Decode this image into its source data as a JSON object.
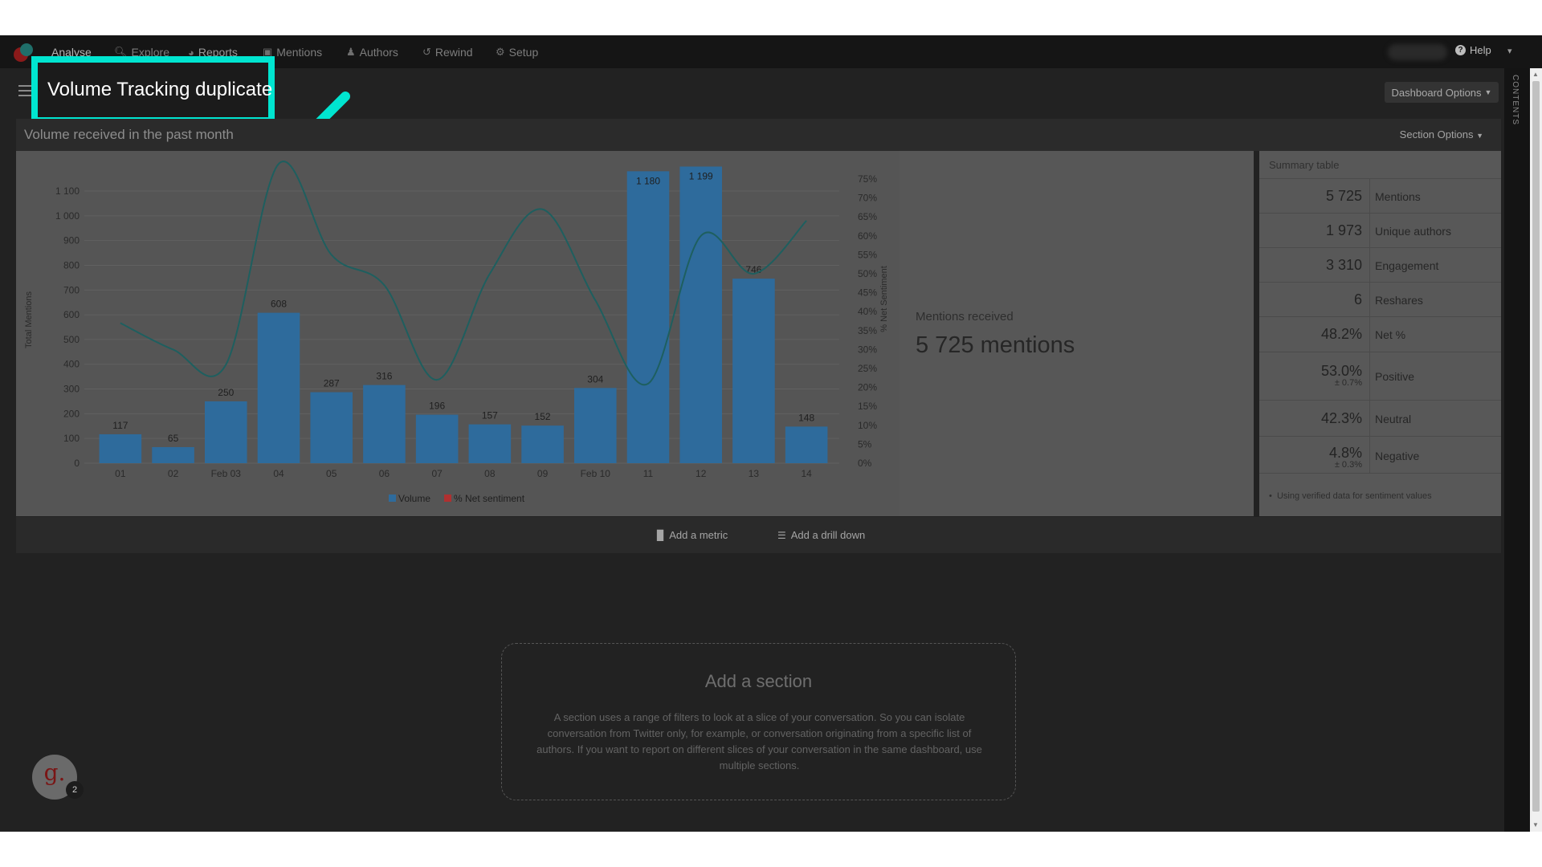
{
  "nav": {
    "items": [
      {
        "label": "Analyse",
        "icon": ""
      },
      {
        "label": "Explore",
        "icon": "search-icon"
      },
      {
        "label": "Reports",
        "icon": "pie-chart-icon"
      },
      {
        "label": "Mentions",
        "icon": "speech-bubble-icon"
      },
      {
        "label": "Authors",
        "icon": "person-icon"
      },
      {
        "label": "Rewind",
        "icon": "history-icon"
      },
      {
        "label": "Setup",
        "icon": "gear-icon"
      }
    ],
    "active": "Reports",
    "help_label": "Help"
  },
  "dashboard": {
    "title": "Volume Tracking duplicate",
    "options_label": "Dashboard Options",
    "contents_label": "CONTENTS"
  },
  "section": {
    "title": "Volume received in the past month",
    "options_label": "Section Options"
  },
  "chart_data": {
    "type": "bar",
    "categories": [
      "01",
      "02",
      "Feb 03",
      "04",
      "05",
      "06",
      "07",
      "08",
      "09",
      "Feb 10",
      "11",
      "12",
      "13",
      "14"
    ],
    "series": [
      {
        "name": "Volume",
        "type": "bar",
        "values": [
          117,
          65,
          250,
          608,
          287,
          316,
          196,
          157,
          152,
          304,
          1180,
          1199,
          746,
          148
        ],
        "value_labels": [
          "117",
          "65",
          "250",
          "608",
          "287",
          "316",
          "196",
          "157",
          "152",
          "304",
          "1 180",
          "1 199",
          "746",
          "148"
        ]
      },
      {
        "name": "% Net sentiment",
        "type": "line",
        "axis": "right",
        "values": [
          37,
          30,
          26,
          79,
          55,
          47,
          22,
          50,
          67,
          43,
          21,
          60,
          50,
          64
        ]
      }
    ],
    "ylabel": "Total Mentions",
    "y2label": "% Net Sentiment",
    "ylim": [
      0,
      1100
    ],
    "y_ticks": [
      "0",
      "100",
      "200",
      "300",
      "400",
      "500",
      "600",
      "700",
      "800",
      "900",
      "1 000",
      "1 100"
    ],
    "y2lim": [
      0,
      75
    ],
    "y2_ticks": [
      "0%",
      "5%",
      "10%",
      "15%",
      "20%",
      "25%",
      "30%",
      "35%",
      "40%",
      "45%",
      "50%",
      "55%",
      "60%",
      "65%",
      "70%",
      "75%"
    ],
    "grid": true,
    "legend": "bottom-center",
    "colors": {
      "bar": "#2e6b9c",
      "line": "#1e5f5f",
      "legend_sentiment": "#b03030"
    }
  },
  "mentions": {
    "label": "Mentions received",
    "value": "5 725 mentions"
  },
  "summary": {
    "title": "Summary table",
    "rows": [
      {
        "value": "5 725",
        "label": "Mentions",
        "sub": ""
      },
      {
        "value": "1 973",
        "label": "Unique authors",
        "sub": ""
      },
      {
        "value": "3 310",
        "label": "Engagement",
        "sub": ""
      },
      {
        "value": "6",
        "label": "Reshares",
        "sub": ""
      },
      {
        "value": "48.2%",
        "label": "Net %",
        "sub": ""
      },
      {
        "value": "53.0%",
        "label": "Positive",
        "sub": "± 0.7%"
      },
      {
        "value": "42.3%",
        "label": "Neutral",
        "sub": ""
      },
      {
        "value": "4.8%",
        "label": "Negative",
        "sub": "± 0.3%"
      }
    ],
    "footnote": "Using verified data for sentiment values"
  },
  "actions": {
    "add_metric": "Add a metric",
    "add_drill_down": "Add a drill down"
  },
  "add_section": {
    "title": "Add a section",
    "description": "A section uses a range of filters to look at a slice of your conversation. So you can isolate conversation from Twitter only, for example, or conversation originating from a specific list of authors. If you want to report on different slices of your conversation in the same dashboard, use multiple sections."
  },
  "chat": {
    "glyph": "g.",
    "badge": "2"
  },
  "colors": {
    "highlight": "#00e5d0",
    "background": "#222222"
  }
}
